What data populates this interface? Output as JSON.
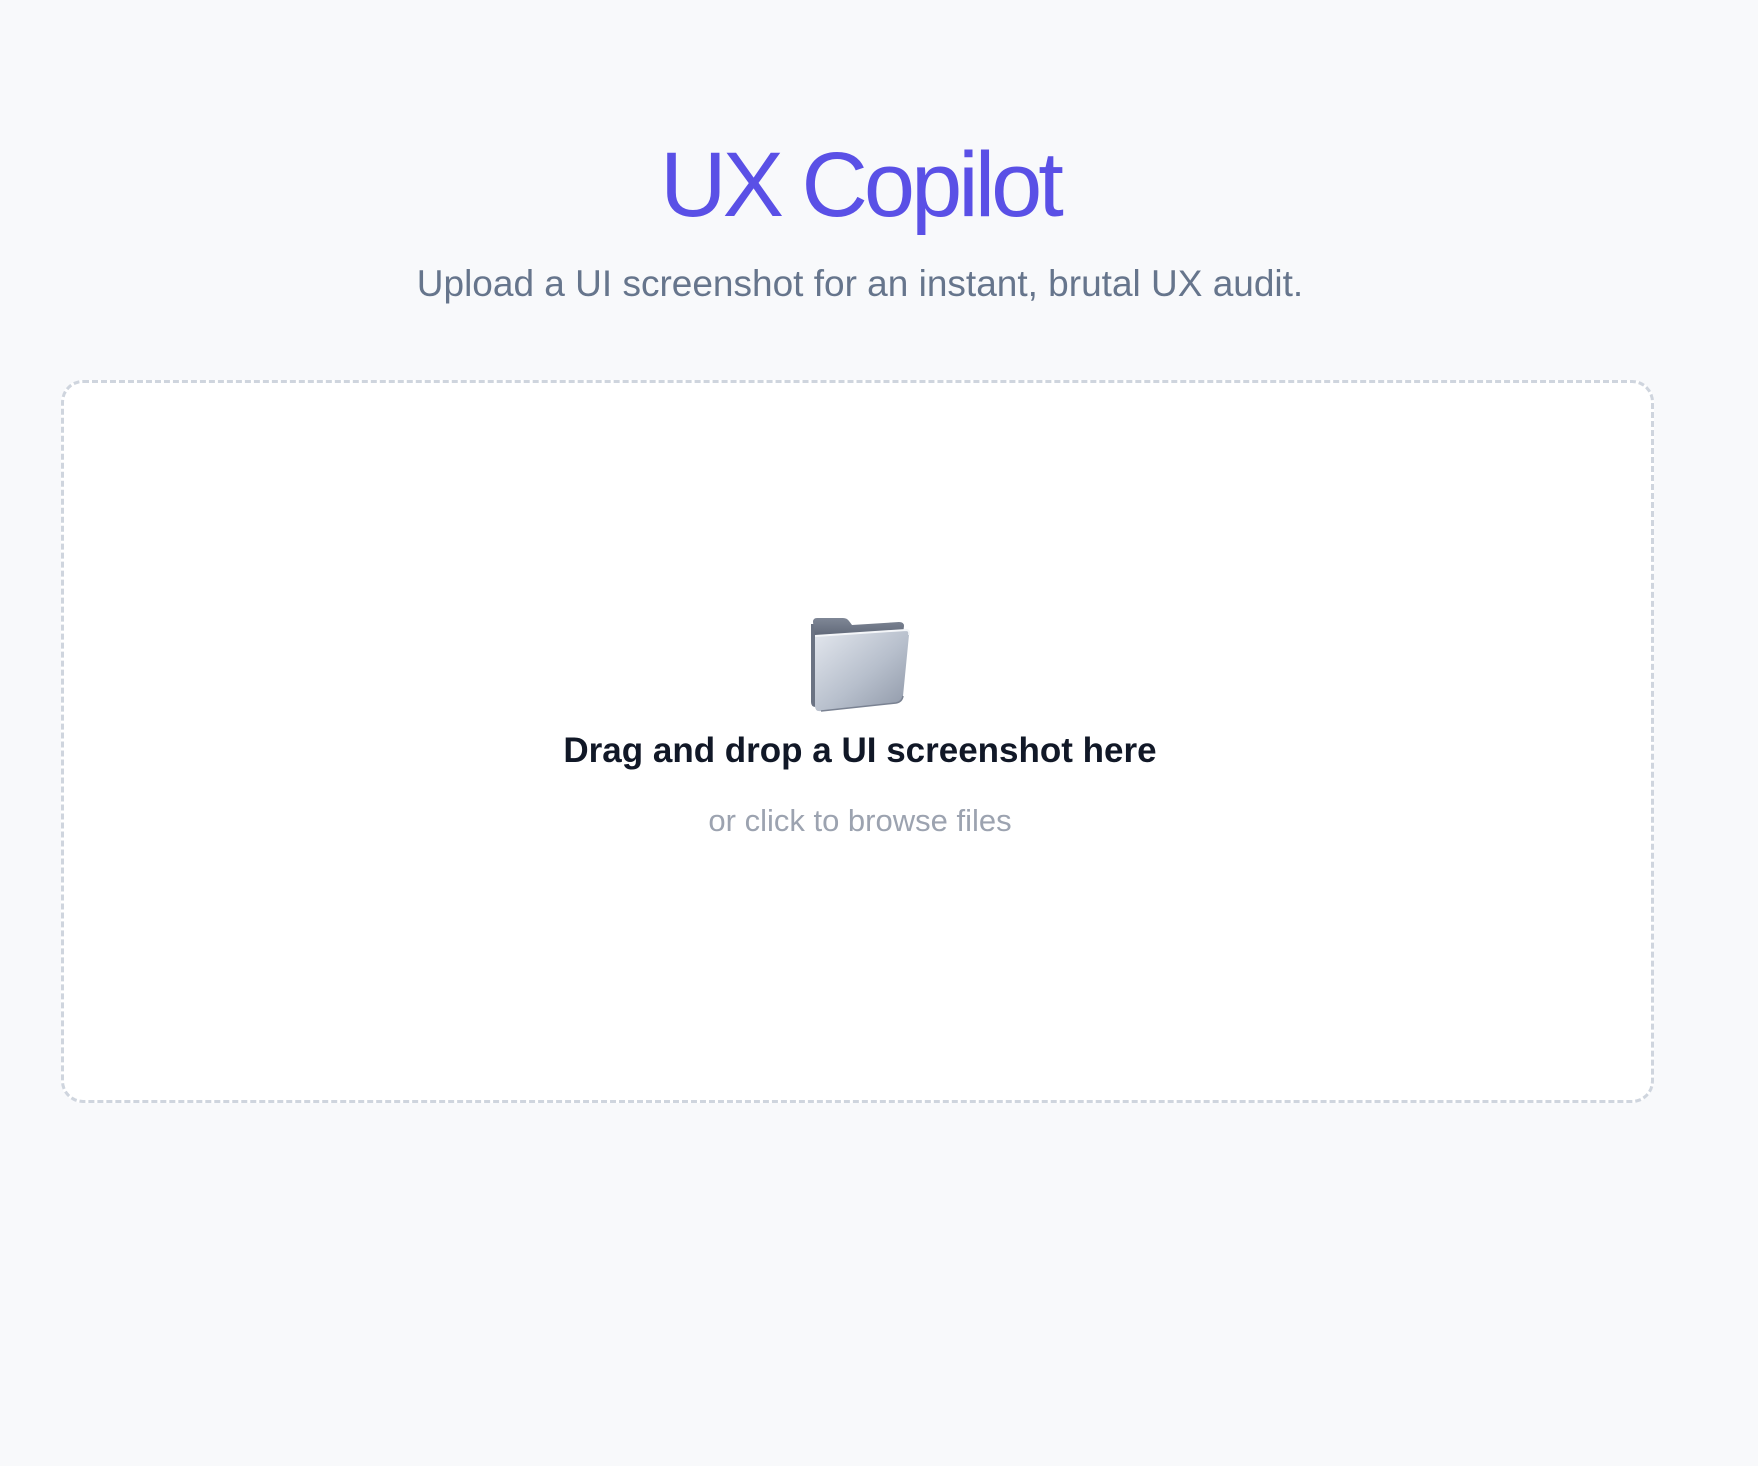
{
  "header": {
    "title": "UX Copilot",
    "subtitle": "Upload a UI screenshot for an instant, brutal UX audit."
  },
  "dropzone": {
    "icon": "folder-icon",
    "primary_text": "Drag and drop a UI screenshot here",
    "secondary_text": "or click to browse files"
  },
  "colors": {
    "accent": "#5a50e6",
    "subtitle": "#66758c",
    "background": "#f8f9fb",
    "dropzone_border": "#cfd5de",
    "primary_text": "#111827",
    "secondary_text": "#9ca3b0"
  }
}
